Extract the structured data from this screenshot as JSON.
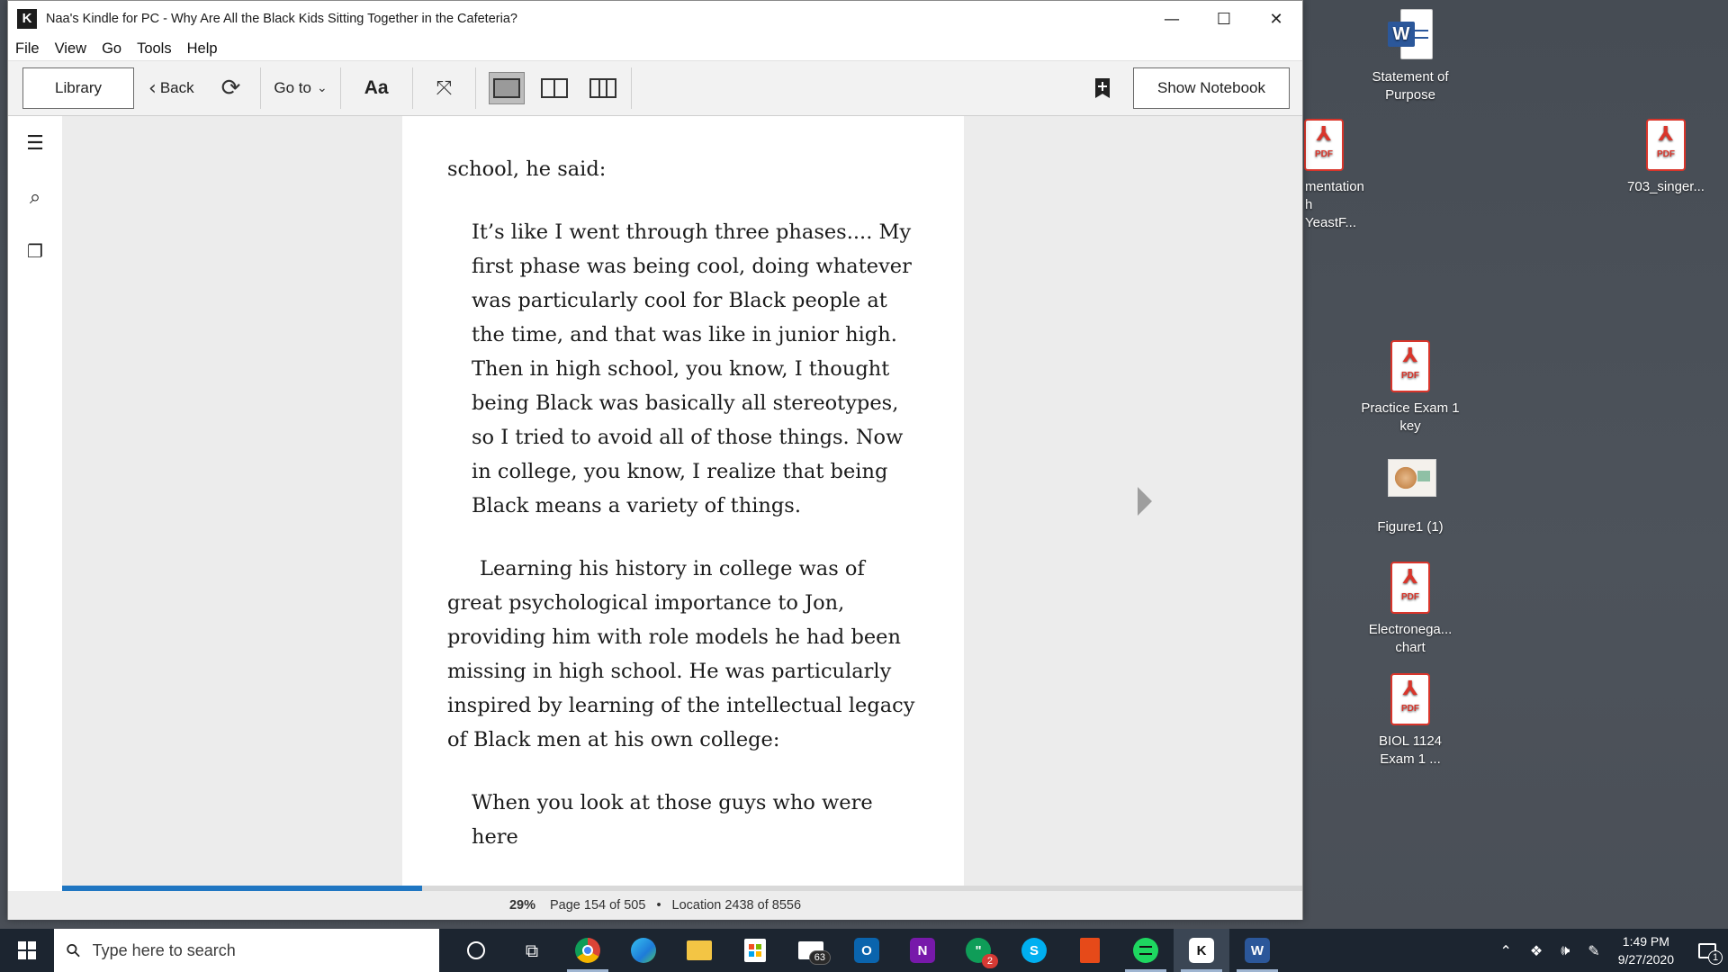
{
  "window": {
    "title": "Naa's Kindle for PC - Why Are All the Black Kids Sitting Together in the Cafeteria?",
    "minimize": "—",
    "maximize": "☐",
    "close": "✕"
  },
  "menu": [
    "File",
    "View",
    "Go",
    "Tools",
    "Help"
  ],
  "toolbar": {
    "library": "Library",
    "back": "Back",
    "goto": "Go to",
    "font": "Aa",
    "show_notebook": "Show Notebook"
  },
  "book": {
    "paragraphs": [
      {
        "kind": "plain",
        "text": "school, he said:"
      },
      {
        "kind": "quote",
        "text": "It’s like I went through three phases.... My first phase was being cool, doing whatever was particularly cool for Black people at the time, and that was like in junior high. Then in high school, you know, I thought being Black was basically all stereotypes, so I tried to avoid all of those things. Now in college, you know, I realize that being Black means a variety of things."
      },
      {
        "kind": "indent",
        "text": "Learning his history in college was of great psychological importance to Jon, providing him with role models he had been missing in high school. He was particularly inspired by learning of the intellectual legacy of Black men at his own college:"
      },
      {
        "kind": "quote",
        "text": "When you look at those guys who were here"
      }
    ]
  },
  "status": {
    "percent": "29%",
    "progress_fraction": 0.29,
    "page": "Page 154 of 505",
    "separator": "•",
    "location": "Location 2438 of 8556"
  },
  "desktop": {
    "icons": [
      {
        "label": "Statement of Purpose",
        "type": "word"
      },
      {
        "label": "mentation h YeastF...",
        "type": "pdf"
      },
      {
        "label": "703_singer...",
        "type": "pdf"
      },
      {
        "label": "Practice Exam 1 key",
        "type": "pdf"
      },
      {
        "label": "Figure1 (1)",
        "type": "image"
      },
      {
        "label": "Electronega... chart",
        "type": "pdf"
      },
      {
        "label": "BIOL 1124 Exam 1 ...",
        "type": "pdf"
      }
    ],
    "pdf_tag": "PDF"
  },
  "taskbar": {
    "search_placeholder": "Type here to search",
    "mail_badge": "63",
    "hangouts_badge": "2",
    "time": "1:49 PM",
    "date": "9/27/2020",
    "notification_count": "1"
  }
}
